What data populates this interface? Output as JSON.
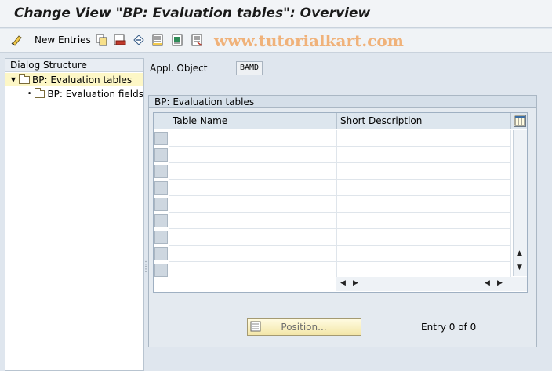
{
  "window": {
    "title": "Change View \"BP: Evaluation tables\": Overview"
  },
  "toolbar": {
    "new_entries_label": "New Entries",
    "icons": [
      "edit-glasses-icon",
      "copy-icon",
      "delete-icon",
      "undo-icon",
      "select-all-icon",
      "select-block-icon",
      "deselect-all-icon"
    ]
  },
  "watermark": "www.tutorialkart.com",
  "dialog": {
    "header": "Dialog Structure",
    "items": [
      {
        "label": "BP: Evaluation tables",
        "selected": true
      },
      {
        "label": "BP: Evaluation fields",
        "selected": false
      }
    ]
  },
  "fields": {
    "appl_object_label": "Appl. Object",
    "appl_object_value": "BAMD"
  },
  "table_group": {
    "title": "BP: Evaluation tables",
    "columns": [
      "Table Name",
      "Short Description"
    ],
    "row_count": 9
  },
  "footer": {
    "position_label": "Position...",
    "entry_count": "Entry 0 of 0"
  },
  "colors": {
    "selected_row": "#fdf7c6",
    "button_yellow": "#f3e6a8",
    "watermark": "#f0b27a"
  }
}
